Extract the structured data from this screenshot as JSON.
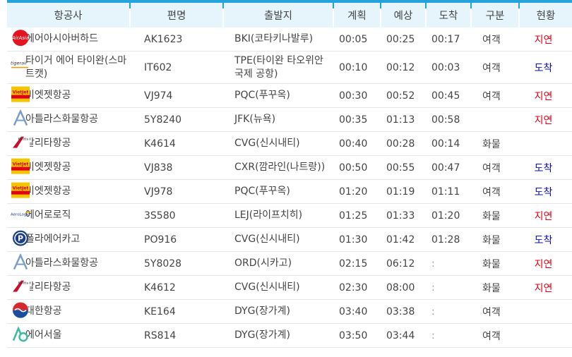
{
  "headers": [
    "항공사",
    "편명",
    "출발지",
    "계획",
    "예상",
    "도착",
    "구분",
    "현황"
  ],
  "colors": {
    "accent": "#25a4d9",
    "header_bg": "#e6f4fb",
    "delay": "#e60012",
    "arrive": "#0a0ac8"
  },
  "rows": [
    {
      "airline": "에어아시아버하드",
      "logo": "airasia-logo",
      "flight": "AK1623",
      "origin": "BKI(코타키나발루)",
      "planned": "00:05",
      "expected": "00:25",
      "arrival": "00:17",
      "type": "여객",
      "status": "지연",
      "status_kind": "delay"
    },
    {
      "airline": "타이거 에어 타이완(스마트캣)",
      "logo": "tigerair-logo",
      "flight": "IT602",
      "origin": "TPE(타이완 타오위안 국제 공항)",
      "planned": "00:10",
      "expected": "00:12",
      "arrival": "00:03",
      "type": "여객",
      "status": "도착",
      "status_kind": "arrive"
    },
    {
      "airline": "비엣젯항공",
      "logo": "vietjet-logo",
      "flight": "VJ974",
      "origin": "PQC(푸꾸옥)",
      "planned": "00:30",
      "expected": "00:52",
      "arrival": "00:45",
      "type": "여객",
      "status": "지연",
      "status_kind": "delay"
    },
    {
      "airline": "아틀라스화물항공",
      "logo": "atlas-logo",
      "flight": "5Y8240",
      "origin": "JFK(뉴욕)",
      "planned": "00:35",
      "expected": "01:13",
      "arrival": "00:58",
      "type": "",
      "status": "지연",
      "status_kind": "delay"
    },
    {
      "airline": "칼리타항공",
      "logo": "kalitta-logo",
      "flight": "K4614",
      "origin": "CVG(신시내티)",
      "planned": "00:40",
      "expected": "00:28",
      "arrival": "00:14",
      "type": "화물",
      "status": "",
      "status_kind": ""
    },
    {
      "airline": "비엣젯항공",
      "logo": "vietjet-logo",
      "flight": "VJ838",
      "origin": "CXR(깜라인(나트랑))",
      "planned": "00:50",
      "expected": "00:55",
      "arrival": "00:47",
      "type": "여객",
      "status": "도착",
      "status_kind": "arrive"
    },
    {
      "airline": "비엣젯항공",
      "logo": "vietjet-logo",
      "flight": "VJ978",
      "origin": "PQC(푸꾸옥)",
      "planned": "01:20",
      "expected": "01:19",
      "arrival": "01:11",
      "type": "여객",
      "status": "도착",
      "status_kind": "arrive"
    },
    {
      "airline": "에어로로직",
      "logo": "aerologic-logo",
      "flight": "3S580",
      "origin": "LEJ(라이프치히)",
      "planned": "01:25",
      "expected": "01:33",
      "arrival": "01:20",
      "type": "화물",
      "status": "지연",
      "status_kind": "delay"
    },
    {
      "airline": "폴라에어카고",
      "logo": "polar-logo",
      "flight": "PO916",
      "origin": "CVG(신시내티)",
      "planned": "01:30",
      "expected": "01:42",
      "arrival": "01:28",
      "type": "화물",
      "status": "도착",
      "status_kind": "arrive"
    },
    {
      "airline": "아틀라스화물항공",
      "logo": "atlas-logo",
      "flight": "5Y8028",
      "origin": "ORD(시카고)",
      "planned": "02:15",
      "expected": "06:12",
      "arrival": ":",
      "type": "화물",
      "status": "지연",
      "status_kind": "delay"
    },
    {
      "airline": "칼리타항공",
      "logo": "kalitta-logo",
      "flight": "K4612",
      "origin": "CVG(신시내티)",
      "planned": "02:30",
      "expected": "08:00",
      "arrival": ":",
      "type": "화물",
      "status": "지연",
      "status_kind": "delay"
    },
    {
      "airline": "대한항공",
      "logo": "koreanair-logo",
      "flight": "KE164",
      "origin": "DYG(장가계)",
      "planned": "03:40",
      "expected": "03:38",
      "arrival": ":",
      "type": "여객",
      "status": "",
      "status_kind": ""
    },
    {
      "airline": "에어서울",
      "logo": "airseoul-logo",
      "flight": "RS814",
      "origin": "DYG(장가계)",
      "planned": "03:50",
      "expected": "03:44",
      "arrival": ":",
      "type": "여객",
      "status": "",
      "status_kind": ""
    }
  ]
}
